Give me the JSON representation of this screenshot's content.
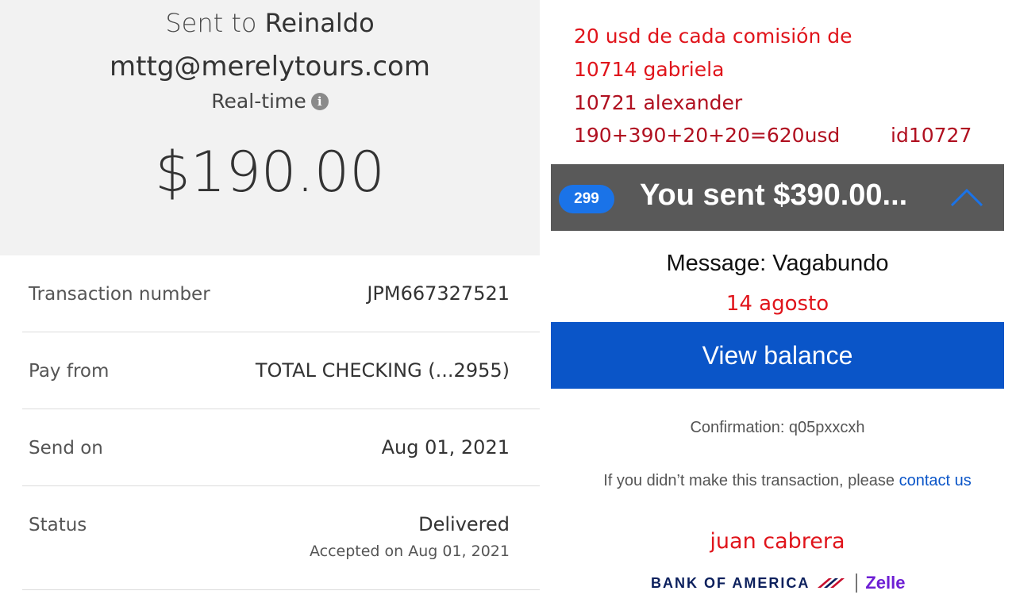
{
  "left": {
    "sent_to_prefix": "Sent to",
    "recipient_name": "Reinaldo",
    "email": "mttg@merelytours.com",
    "delivery_speed": "Real-time",
    "info_icon_glyph": "i",
    "amount": "$190.00",
    "rows": [
      {
        "label": "Transaction number",
        "value": "JPM667327521"
      },
      {
        "label": "Pay from",
        "value": "TOTAL CHECKING (...2955)"
      },
      {
        "label": "Send on",
        "value": "Aug 01, 2021"
      },
      {
        "label": "Status",
        "value": "Delivered",
        "sub": "Accepted on Aug 01, 2021"
      }
    ]
  },
  "right": {
    "notes": [
      "20 usd de cada comisión de",
      "10714 gabriela",
      "10721 alexander",
      "190+390+20+20=620usd"
    ],
    "note_id": "id10727",
    "notification": {
      "badge": "299",
      "text": "You sent $390.00...",
      "icon": "chevron-up-icon"
    },
    "message": "Message: Vagabundo",
    "date_note": "14 agosto",
    "view_balance": "View balance",
    "confirmation": "Confirmation: q05pxxcxh",
    "disclaimer_text": "If you didn’t make this transaction, please",
    "disclaimer_link": "contact us",
    "signature": "juan cabrera",
    "footer": {
      "bank": "BANK OF AMERICA",
      "zelle": "Zelle"
    }
  },
  "colors": {
    "annotation_red": "#e0141b",
    "annotation_darkred": "#b01020",
    "notif_bg": "#595959",
    "badge_blue": "#1a73e8",
    "button_blue": "#0a55c8",
    "zelle_purple": "#6d1ed4",
    "boa_navy": "#0b1f5c"
  }
}
